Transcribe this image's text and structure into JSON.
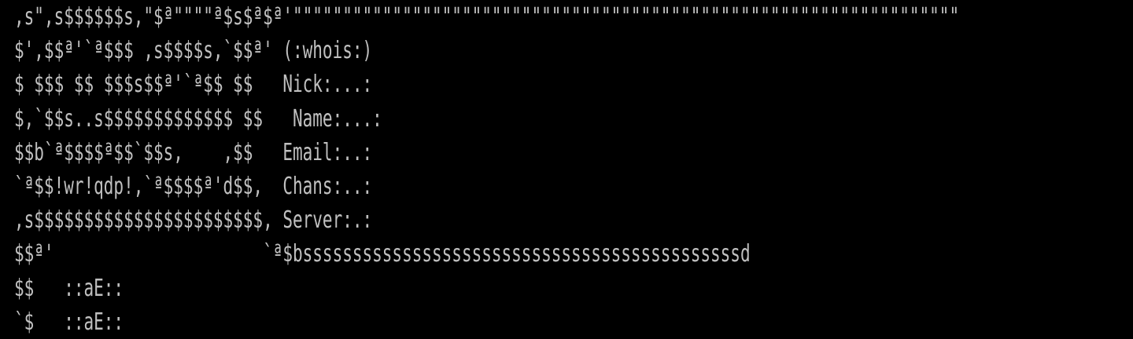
{
  "terminal": {
    "foreground_color": "#c0c0c0",
    "background_color": "#000000",
    "lines": [
      ",s\",s$$$$$$s,\"$ª\"\"\"\"ª$s$ª$ª'\"\"\"\"\"\"\"\"\"\"\"\"\"\"\"\"\"\"\"\"\"\"\"\"\"\"\"\"\"\"\"\"\"\"\"\"\"\"\"\"\"\"\"\"\"\"\"\"\"\"\"\"\"\"\"\"\"\"\"\"\"\"\"\"\"\"\"",
      "$',$$ª'`ª$$$ ,s$$$$s,`$$ª' (:whois:)",
      "$ $$$ $$ $$$s$$ª'`ª$$ $$   Nick:...:",
      "$,`$$s..s$$$$$$$$$$$$$ $$   Name:...:",
      "$$b`ª$$$$ª$$`$$s,    ,$$   Email:..:",
      "`ª$$!wr!qdp!,`ª$$$$ª'd$$,  Chans:..:",
      ",s$$$$$$$$$$$$$$$$$$$$$$$, Server:.:",
      "$$ª'                     `ª$bssssssssssssssssssssssssssssssssssssssssssssd",
      "$$   ::aE::",
      "`$   ::aE::"
    ]
  }
}
